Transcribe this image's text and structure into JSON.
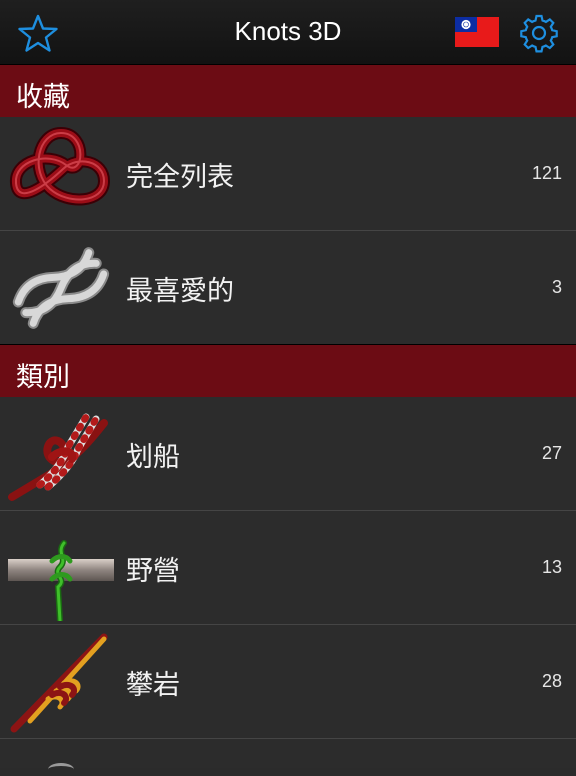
{
  "navbar": {
    "title": "Knots 3D",
    "left_icon": "star-icon",
    "flag_icon": "taiwan-flag-icon",
    "right_icon": "gear-icon"
  },
  "sections": {
    "favorites_header": "收藏",
    "categories_header": "類別"
  },
  "rows": [
    {
      "label": "完全列表",
      "count": "121",
      "icon": "trefoil-knot-icon"
    },
    {
      "label": "最喜愛的",
      "count": "3",
      "icon": "braided-knot-icon"
    },
    {
      "label": "划船",
      "count": "27",
      "icon": "boating-knot-icon"
    },
    {
      "label": "野營",
      "count": "13",
      "icon": "camping-knot-icon"
    },
    {
      "label": "攀岩",
      "count": "28",
      "icon": "climbing-knot-icon"
    }
  ],
  "colors": {
    "accent_blue": "#1e8fe0",
    "section_red": "#6c0c14",
    "row_bg": "#2c2c2c"
  }
}
